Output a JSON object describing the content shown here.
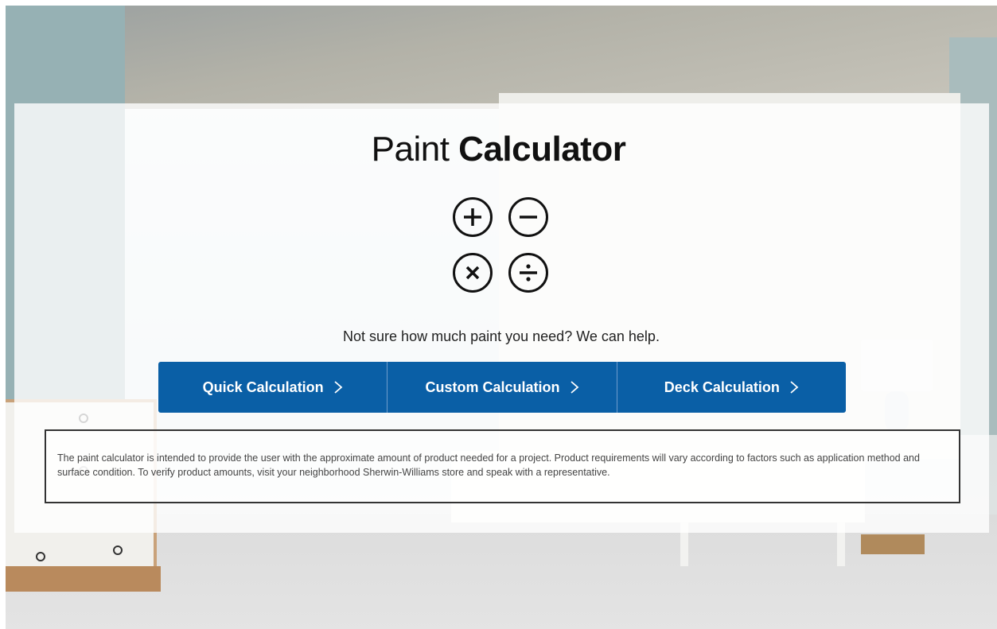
{
  "title": {
    "light": "Paint ",
    "bold": "Calculator"
  },
  "icons": [
    "plus-circle-icon",
    "minus-circle-icon",
    "times-circle-icon",
    "divide-circle-icon"
  ],
  "tagline": "Not sure how much paint you need? We can help.",
  "buttons": [
    {
      "label": "Quick Calculation"
    },
    {
      "label": "Custom Calculation"
    },
    {
      "label": "Deck Calculation"
    }
  ],
  "disclaimer": "The paint calculator is intended to provide the user with the approximate amount of product needed for a project. Product requirements will vary according to factors such as application method and surface condition. To verify product amounts, visit your neighborhood Sherwin-Williams store and speak with a representative.",
  "colors": {
    "button": "#0a5fa6",
    "panel": "rgba(255,255,255,0.80)"
  }
}
